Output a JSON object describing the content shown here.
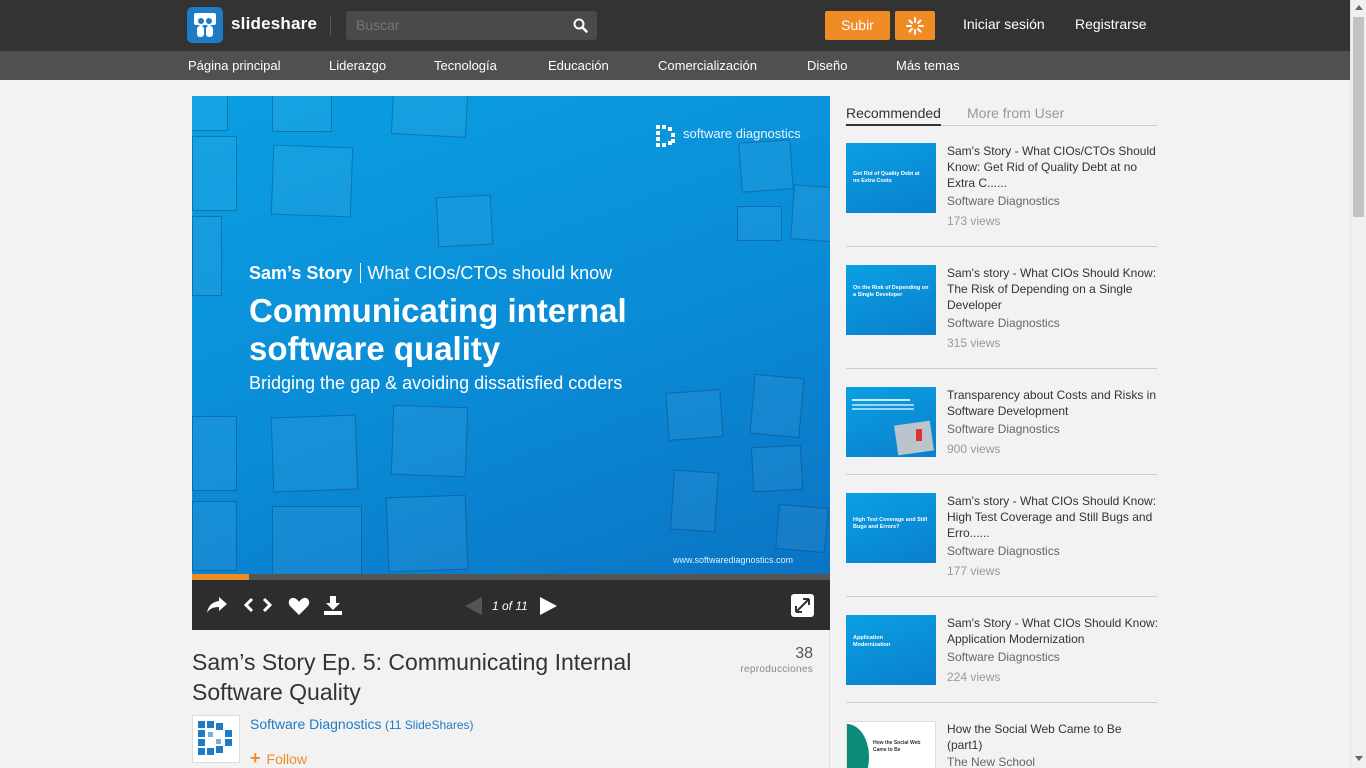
{
  "header": {
    "brand": "slideshare",
    "search_placeholder": "Buscar",
    "upload_label": "Subir",
    "login_label": "Iniciar sesión",
    "register_label": "Registrarse",
    "brand_color": "#f08c26"
  },
  "categories": [
    "Página principal",
    "Liderazgo",
    "Tecnología",
    "Educación",
    "Comercialización",
    "Diseño",
    "Más temas"
  ],
  "slide": {
    "brand": "software diagnostics",
    "kicker_bold": "Sam’s Story",
    "kicker_rest": "What CIOs/CTOs should know",
    "title": "Communicating internal software quality",
    "subtitle": "Bridging the gap & avoiding dissatisfied coders",
    "url": "www.softwarediagnostics.com"
  },
  "player": {
    "page_indicator": "1 of 11",
    "progress_fraction": 0.09,
    "icons": [
      "share-icon",
      "embed-icon",
      "like-icon",
      "download-icon",
      "prev-icon",
      "next-icon",
      "fullscreen-icon"
    ]
  },
  "document": {
    "title": "Sam’s Story Ep. 5: Communicating Internal Software Quality",
    "views": "38",
    "views_label": "reproducciones",
    "author": "Software Diagnostics",
    "author_count": "(11 SlideShares)",
    "follow_label": "Follow"
  },
  "sidebar": {
    "tabs": [
      "Recommended",
      "More from User"
    ],
    "items": [
      {
        "title": "Sam's Story - What CIOs/CTOs Should Know: Get Rid of Quality Debt at no Extra C......",
        "author": "Software Diagnostics",
        "views": "173 views",
        "thumb_text": "Get Rid of Quality Debt at no Extra Costs"
      },
      {
        "title": "Sam's story - What CIOs Should Know: The Risk of Depending on a Single Developer",
        "author": "Software Diagnostics",
        "views": "315 views",
        "thumb_text": "On the Risk of Depending on a Single Developer"
      },
      {
        "title": "Transparency about Costs and Risks in Software Development",
        "author": "Software Diagnostics",
        "views": "900 views",
        "thumb_text": ""
      },
      {
        "title": "Sam's story - What CIOs Should Know: High Test Coverage and Still Bugs and Erro......",
        "author": "Software Diagnostics",
        "views": "177 views",
        "thumb_text": "High Test Coverage and Still Bugs and Errors?"
      },
      {
        "title": "Sam's Story - What CIOs Should Know: Application Modernization",
        "author": "Software Diagnostics",
        "views": "224 views",
        "thumb_text": "Application Modernization"
      },
      {
        "title": "How the Social Web Came to Be (part1)",
        "author": "The New School",
        "views": "",
        "thumb_text": "How the Social Web Came to Be"
      }
    ]
  }
}
